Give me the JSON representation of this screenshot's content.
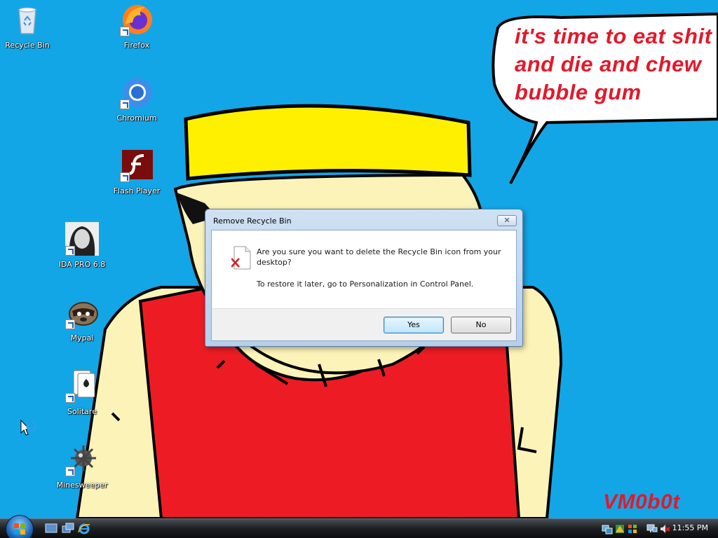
{
  "wallpaper": {
    "speech_lines": [
      "it's time to eat shit",
      "and die and chew",
      "bubble gum"
    ],
    "signature": "VM0b0t"
  },
  "desktop_icons": [
    {
      "label": "Recycle Bin",
      "icon": "recycle-bin-icon"
    },
    {
      "label": "Firefox",
      "icon": "firefox-icon"
    },
    {
      "label": "Chromium",
      "icon": "chromium-icon"
    },
    {
      "label": "Flash Player",
      "icon": "flash-player-icon"
    },
    {
      "label": "IDA PRO 6.8",
      "icon": "ida-pro-icon"
    },
    {
      "label": "Mypal",
      "icon": "mypal-icon"
    },
    {
      "label": "Solitare",
      "icon": "solitaire-icon"
    },
    {
      "label": "Minesweeper",
      "icon": "minesweeper-icon"
    }
  ],
  "dialog": {
    "title": "Remove Recycle Bin",
    "close_label": "✕",
    "message": "Are you sure you want to delete the Recycle Bin icon from your desktop?",
    "hint": "To restore it later, go to Personalization in Control Panel.",
    "yes_label": "Yes",
    "no_label": "No"
  },
  "taskbar": {
    "quick_launch": [
      "show-desktop-icon",
      "switch-windows-icon",
      "internet-explorer-icon"
    ],
    "clock": "11:55 PM"
  },
  "colors": {
    "desktop": "#13a6e6",
    "wallpaper_text": "#e2192b",
    "skin": "#fbf3b8",
    "cap": "#fff000",
    "shirt": "#ed1c24"
  }
}
